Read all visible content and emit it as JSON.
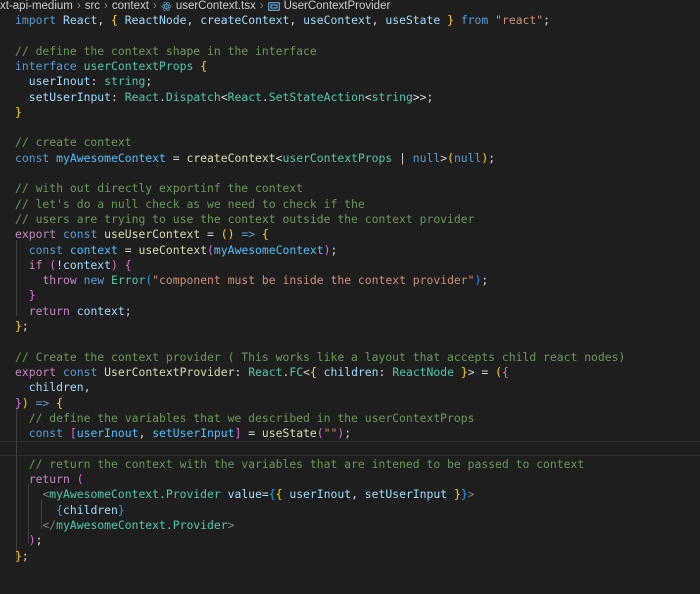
{
  "breadcrumb": {
    "items": [
      "xt-api-medium",
      "src",
      "context",
      "userContext.tsx",
      "UserContextProvider"
    ]
  },
  "code_lines": [
    [
      [
        "kw",
        "import"
      ],
      [
        "pl",
        " "
      ],
      [
        "var",
        "React"
      ],
      [
        "pl",
        ", "
      ],
      [
        "br1",
        "{"
      ],
      [
        "pl",
        " "
      ],
      [
        "var",
        "ReactNode"
      ],
      [
        "pl",
        ", "
      ],
      [
        "var",
        "createContext"
      ],
      [
        "pl",
        ", "
      ],
      [
        "var",
        "useContext"
      ],
      [
        "pl",
        ", "
      ],
      [
        "var",
        "useState"
      ],
      [
        "pl",
        " "
      ],
      [
        "br1",
        "}"
      ],
      [
        "pl",
        " "
      ],
      [
        "kw",
        "from"
      ],
      [
        "pl",
        " "
      ],
      [
        "str",
        "\"react\""
      ],
      [
        "pl",
        ";"
      ]
    ],
    [],
    [
      [
        "com",
        "// define the context shape in the interface"
      ]
    ],
    [
      [
        "kw",
        "interface"
      ],
      [
        "pl",
        " "
      ],
      [
        "ty",
        "userContextProps"
      ],
      [
        "pl",
        " "
      ],
      [
        "br1",
        "{"
      ]
    ],
    [
      [
        "pl",
        "  "
      ],
      [
        "var",
        "userInout"
      ],
      [
        "pl",
        ": "
      ],
      [
        "ty",
        "string"
      ],
      [
        "pl",
        ";"
      ]
    ],
    [
      [
        "pl",
        "  "
      ],
      [
        "var",
        "setUserInput"
      ],
      [
        "pl",
        ": "
      ],
      [
        "ty",
        "React"
      ],
      [
        "pl",
        "."
      ],
      [
        "ty",
        "Dispatch"
      ],
      [
        "pl",
        "<"
      ],
      [
        "ty",
        "React"
      ],
      [
        "pl",
        "."
      ],
      [
        "ty",
        "SetStateAction"
      ],
      [
        "pl",
        "<"
      ],
      [
        "ty",
        "string"
      ],
      [
        "pl",
        ">>;"
      ]
    ],
    [
      [
        "br1",
        "}"
      ]
    ],
    [],
    [
      [
        "com",
        "// create context"
      ]
    ],
    [
      [
        "kw",
        "const"
      ],
      [
        "pl",
        " "
      ],
      [
        "cst",
        "myAwesomeContext"
      ],
      [
        "pl",
        " = "
      ],
      [
        "fn",
        "createContext"
      ],
      [
        "pl",
        "<"
      ],
      [
        "ty",
        "userContextProps"
      ],
      [
        "pl",
        " | "
      ],
      [
        "kw",
        "null"
      ],
      [
        "pl",
        ">"
      ],
      [
        "br1",
        "("
      ],
      [
        "kw",
        "null"
      ],
      [
        "br1",
        ")"
      ],
      [
        "pl",
        ";"
      ]
    ],
    [],
    [
      [
        "com",
        "// with out directly exportinf the context"
      ]
    ],
    [
      [
        "com",
        "// let's do a null check as we need to check if the"
      ]
    ],
    [
      [
        "com",
        "// users are trying to use the context outside the context provider"
      ]
    ],
    [
      [
        "ctl",
        "export"
      ],
      [
        "pl",
        " "
      ],
      [
        "kw",
        "const"
      ],
      [
        "pl",
        " "
      ],
      [
        "fn",
        "useUserContext"
      ],
      [
        "pl",
        " = "
      ],
      [
        "br1",
        "()"
      ],
      [
        "pl",
        " "
      ],
      [
        "kw",
        "=>"
      ],
      [
        "pl",
        " "
      ],
      [
        "br1",
        "{"
      ]
    ],
    [
      [
        "pl",
        "  "
      ],
      [
        "kw",
        "const"
      ],
      [
        "pl",
        " "
      ],
      [
        "cst",
        "context"
      ],
      [
        "pl",
        " = "
      ],
      [
        "fn",
        "useContext"
      ],
      [
        "br2",
        "("
      ],
      [
        "cst",
        "myAwesomeContext"
      ],
      [
        "br2",
        ")"
      ],
      [
        "pl",
        ";"
      ]
    ],
    [
      [
        "pl",
        "  "
      ],
      [
        "ctl",
        "if"
      ],
      [
        "pl",
        " "
      ],
      [
        "br2",
        "("
      ],
      [
        "pl",
        "!"
      ],
      [
        "var",
        "context"
      ],
      [
        "br2",
        ")"
      ],
      [
        "pl",
        " "
      ],
      [
        "br2",
        "{"
      ]
    ],
    [
      [
        "pl",
        "    "
      ],
      [
        "ctl",
        "throw"
      ],
      [
        "pl",
        " "
      ],
      [
        "kw",
        "new"
      ],
      [
        "pl",
        " "
      ],
      [
        "ty",
        "Error"
      ],
      [
        "br3",
        "("
      ],
      [
        "str",
        "\"component must be inside the context provider\""
      ],
      [
        "br3",
        ")"
      ],
      [
        "pl",
        ";"
      ]
    ],
    [
      [
        "pl",
        "  "
      ],
      [
        "br2",
        "}"
      ]
    ],
    [
      [
        "pl",
        "  "
      ],
      [
        "ctl",
        "return"
      ],
      [
        "pl",
        " "
      ],
      [
        "var",
        "context"
      ],
      [
        "pl",
        ";"
      ]
    ],
    [
      [
        "br1",
        "}"
      ],
      [
        "pl",
        ";"
      ]
    ],
    [],
    [
      [
        "com",
        "// Create the context provider ( This works like a layout that accepts child react nodes)"
      ]
    ],
    [
      [
        "ctl",
        "export"
      ],
      [
        "pl",
        " "
      ],
      [
        "kw",
        "const"
      ],
      [
        "pl",
        " "
      ],
      [
        "fn",
        "UserContextProvider"
      ],
      [
        "pl",
        ": "
      ],
      [
        "ty",
        "React"
      ],
      [
        "pl",
        "."
      ],
      [
        "ty",
        "FC"
      ],
      [
        "pl",
        "<"
      ],
      [
        "br1",
        "{"
      ],
      [
        "pl",
        " "
      ],
      [
        "var",
        "children"
      ],
      [
        "pl",
        ": "
      ],
      [
        "ty",
        "ReactNode"
      ],
      [
        "pl",
        " "
      ],
      [
        "br1",
        "}"
      ],
      [
        "pl",
        "> = "
      ],
      [
        "br1",
        "("
      ],
      [
        "br2",
        "{"
      ]
    ],
    [
      [
        "pl",
        "  "
      ],
      [
        "var",
        "children"
      ],
      [
        "pl",
        ","
      ]
    ],
    [
      [
        "br2",
        "}"
      ],
      [
        "br1",
        ")"
      ],
      [
        "pl",
        " "
      ],
      [
        "kw",
        "=>"
      ],
      [
        "pl",
        " "
      ],
      [
        "br1",
        "{"
      ]
    ],
    [
      [
        "pl",
        "  "
      ],
      [
        "com",
        "// define the variables that we described in the userContextProps"
      ]
    ],
    [
      [
        "pl",
        "  "
      ],
      [
        "kw",
        "const"
      ],
      [
        "pl",
        " "
      ],
      [
        "br2",
        "["
      ],
      [
        "cst",
        "userInout"
      ],
      [
        "pl",
        ", "
      ],
      [
        "cst",
        "setUserInput"
      ],
      [
        "br2",
        "]"
      ],
      [
        "pl",
        " = "
      ],
      [
        "fn",
        "useState"
      ],
      [
        "br2",
        "("
      ],
      [
        "str",
        "\"\""
      ],
      [
        "br2",
        ")"
      ],
      [
        "pl",
        ";"
      ]
    ],
    [],
    [
      [
        "pl",
        "  "
      ],
      [
        "com",
        "// return the context with the variables that are intened to be passed to context"
      ]
    ],
    [
      [
        "pl",
        "  "
      ],
      [
        "ctl",
        "return"
      ],
      [
        "pl",
        " "
      ],
      [
        "br2",
        "("
      ]
    ],
    [
      [
        "pl",
        "    "
      ],
      [
        "tag",
        "<"
      ],
      [
        "ty",
        "myAwesomeContext.Provider"
      ],
      [
        "pl",
        " "
      ],
      [
        "var",
        "value"
      ],
      [
        "pl",
        "="
      ],
      [
        "br3",
        "{"
      ],
      [
        "br1",
        "{"
      ],
      [
        "pl",
        " "
      ],
      [
        "var",
        "userInout"
      ],
      [
        "pl",
        ", "
      ],
      [
        "var",
        "setUserInput"
      ],
      [
        "pl",
        " "
      ],
      [
        "br1",
        "}"
      ],
      [
        "br3",
        "}"
      ],
      [
        "tag",
        ">"
      ]
    ],
    [
      [
        "pl",
        "      "
      ],
      [
        "br3",
        "{"
      ],
      [
        "var",
        "children"
      ],
      [
        "br3",
        "}"
      ]
    ],
    [
      [
        "pl",
        "    "
      ],
      [
        "tag",
        "</"
      ],
      [
        "ty",
        "myAwesomeContext.Provider"
      ],
      [
        "tag",
        ">"
      ]
    ],
    [
      [
        "pl",
        "  "
      ],
      [
        "br2",
        ")"
      ],
      [
        "pl",
        ";"
      ]
    ],
    [
      [
        "br1",
        "}"
      ],
      [
        "pl",
        ";"
      ]
    ]
  ]
}
